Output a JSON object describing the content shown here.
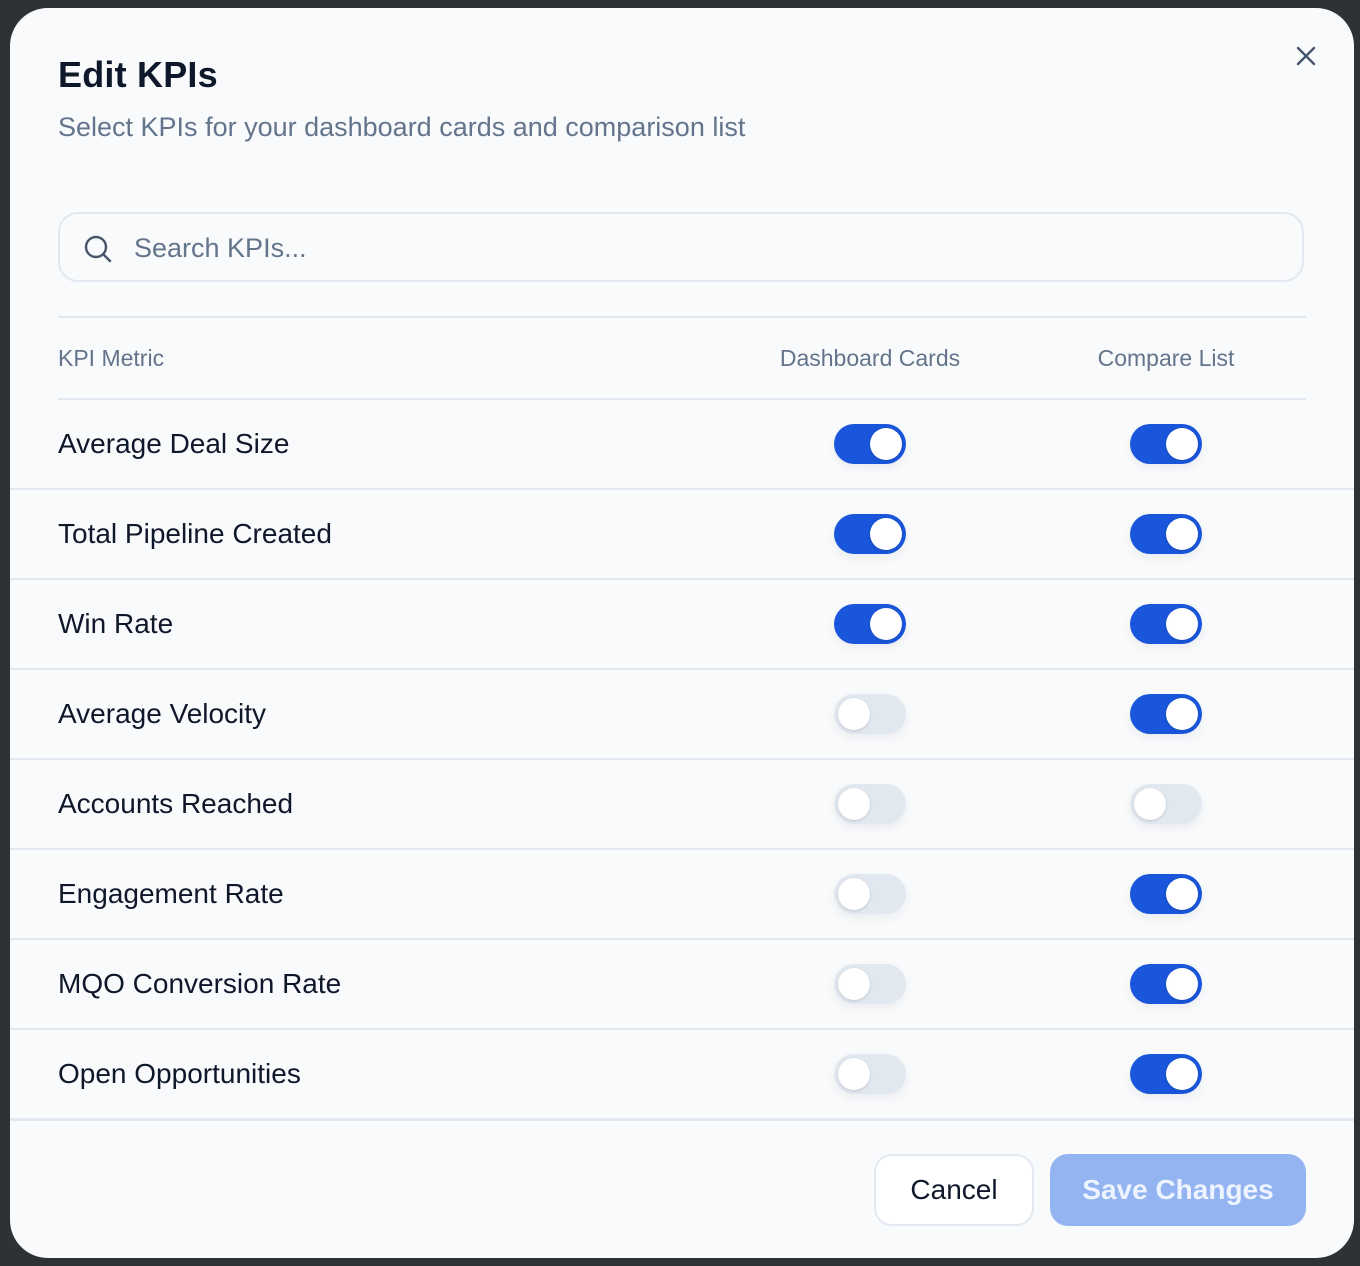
{
  "dialog": {
    "title": "Edit KPIs",
    "subtitle": "Select KPIs for your dashboard cards and comparison list"
  },
  "search": {
    "placeholder": "Search KPIs...",
    "value": "",
    "icon": "search-icon"
  },
  "table": {
    "headers": {
      "metric": "KPI Metric",
      "dashboard": "Dashboard Cards",
      "compare": "Compare List"
    },
    "rows": [
      {
        "label": "Average Deal Size",
        "dashboard": true,
        "compare": true
      },
      {
        "label": "Total Pipeline Created",
        "dashboard": true,
        "compare": true
      },
      {
        "label": "Win Rate",
        "dashboard": true,
        "compare": true
      },
      {
        "label": "Average Velocity",
        "dashboard": false,
        "compare": true
      },
      {
        "label": "Accounts Reached",
        "dashboard": false,
        "compare": false
      },
      {
        "label": "Engagement Rate",
        "dashboard": false,
        "compare": true
      },
      {
        "label": "MQO Conversion Rate",
        "dashboard": false,
        "compare": true
      },
      {
        "label": "Open Opportunities",
        "dashboard": false,
        "compare": true
      }
    ]
  },
  "footer": {
    "cancel_label": "Cancel",
    "save_label": "Save Changes"
  },
  "colors": {
    "accent": "#1a56db",
    "toggle_off": "#e2e8f0",
    "save_disabled": "#93b4f0"
  }
}
